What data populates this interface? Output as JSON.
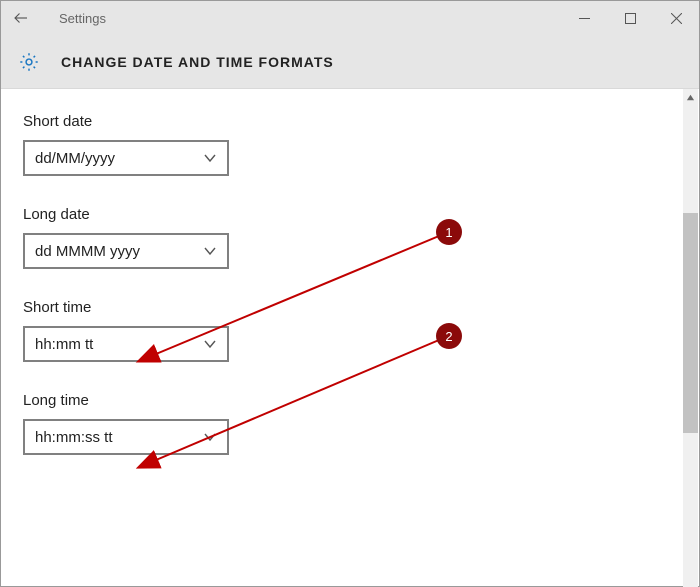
{
  "window": {
    "title": "Settings"
  },
  "page": {
    "heading": "CHANGE DATE AND TIME FORMATS"
  },
  "fields": {
    "short_date": {
      "label": "Short date",
      "value": "dd/MM/yyyy"
    },
    "long_date": {
      "label": "Long date",
      "value": "dd MMMM yyyy"
    },
    "short_time": {
      "label": "Short time",
      "value": "hh:mm tt"
    },
    "long_time": {
      "label": "Long time",
      "value": "hh:mm:ss tt"
    }
  },
  "annotations": {
    "callout1": "1",
    "callout2": "2",
    "color": "#8b0a0a"
  }
}
